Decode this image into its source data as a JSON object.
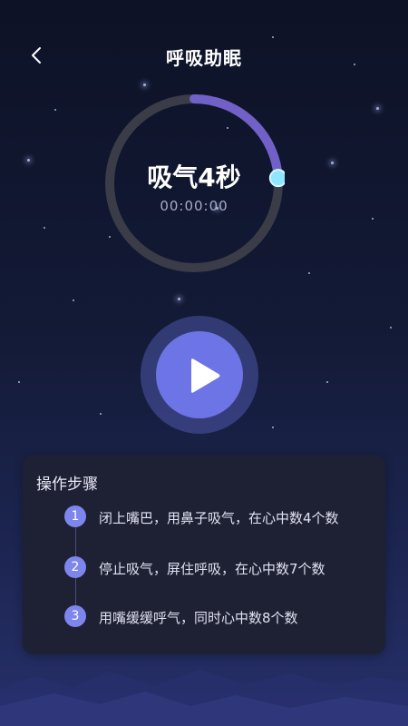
{
  "header": {
    "title": "呼吸助眠",
    "back_icon": "chevron-left-icon"
  },
  "breath": {
    "phase_label": "吸气4秒",
    "timer": "00:00:00",
    "progress_fraction": 0.12
  },
  "controls": {
    "play_icon": "play-icon"
  },
  "instructions": {
    "title": "操作步骤",
    "steps": [
      {
        "num": "1",
        "text": "闭上嘴巴，用鼻子吸气，在心中数4个数"
      },
      {
        "num": "2",
        "text": "停止吸气，屏住呼吸，在心中数7个数"
      },
      {
        "num": "3",
        "text": "用嘴缓缓呼气，同时心中数8个数"
      }
    ]
  },
  "colors": {
    "accent": "#6d75e6",
    "ring_track": "#3a3c47",
    "ring_progress": "#7060c8",
    "knob": "#8fe6ff"
  }
}
